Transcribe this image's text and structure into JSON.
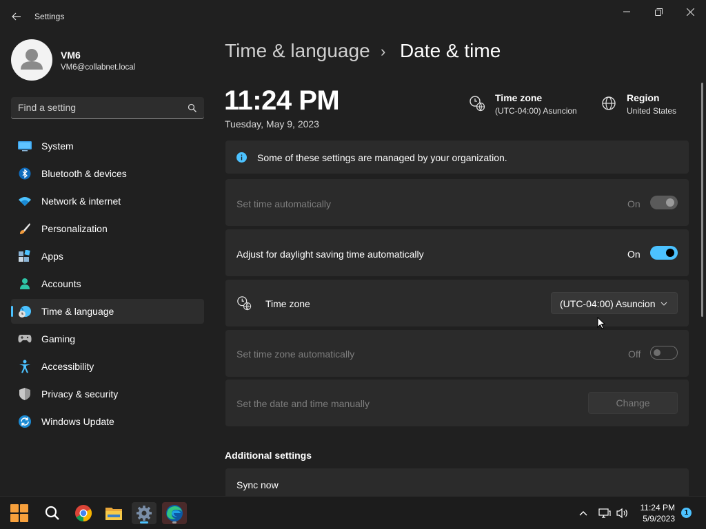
{
  "window": {
    "title": "Settings"
  },
  "profile": {
    "name": "VM6",
    "email": "VM6@collabnet.local"
  },
  "search": {
    "placeholder": "Find a setting"
  },
  "sidebar": {
    "items": [
      {
        "label": "System",
        "icon": "monitor-icon"
      },
      {
        "label": "Bluetooth & devices",
        "icon": "bluetooth-icon"
      },
      {
        "label": "Network & internet",
        "icon": "wifi-icon"
      },
      {
        "label": "Personalization",
        "icon": "brush-icon"
      },
      {
        "label": "Apps",
        "icon": "apps-icon"
      },
      {
        "label": "Accounts",
        "icon": "person-icon"
      },
      {
        "label": "Time & language",
        "icon": "globe-clock-icon",
        "active": true
      },
      {
        "label": "Gaming",
        "icon": "gamepad-icon"
      },
      {
        "label": "Accessibility",
        "icon": "accessibility-icon"
      },
      {
        "label": "Privacy & security",
        "icon": "shield-icon"
      },
      {
        "label": "Windows Update",
        "icon": "update-icon"
      }
    ]
  },
  "header": {
    "parent": "Time & language",
    "separator": "›",
    "current": "Date & time"
  },
  "clock": {
    "time": "11:24 PM",
    "date": "Tuesday, May 9, 2023"
  },
  "info_tiles": {
    "timezone_title": "Time zone",
    "timezone_value": "(UTC-04:00) Asuncion",
    "region_title": "Region",
    "region_value": "United States"
  },
  "notice": {
    "text": "Some of these settings are managed by your organization."
  },
  "settings": {
    "set_time_auto": {
      "label": "Set time automatically",
      "state": "On"
    },
    "daylight": {
      "label": "Adjust for daylight saving time automatically",
      "state": "On"
    },
    "timezone": {
      "label": "Time zone",
      "value": "(UTC-04:00) Asuncion"
    },
    "set_tz_auto": {
      "label": "Set time zone automatically",
      "state": "Off"
    },
    "manual": {
      "label": "Set the date and time manually",
      "button": "Change"
    }
  },
  "additional": {
    "title": "Additional settings",
    "sync_label": "Sync now"
  },
  "taskbar": {
    "time": "11:24 PM",
    "date": "5/9/2023",
    "notifications": "1"
  },
  "colors": {
    "accent": "#4cc2ff",
    "background": "#202020",
    "card": "#2b2b2b"
  }
}
